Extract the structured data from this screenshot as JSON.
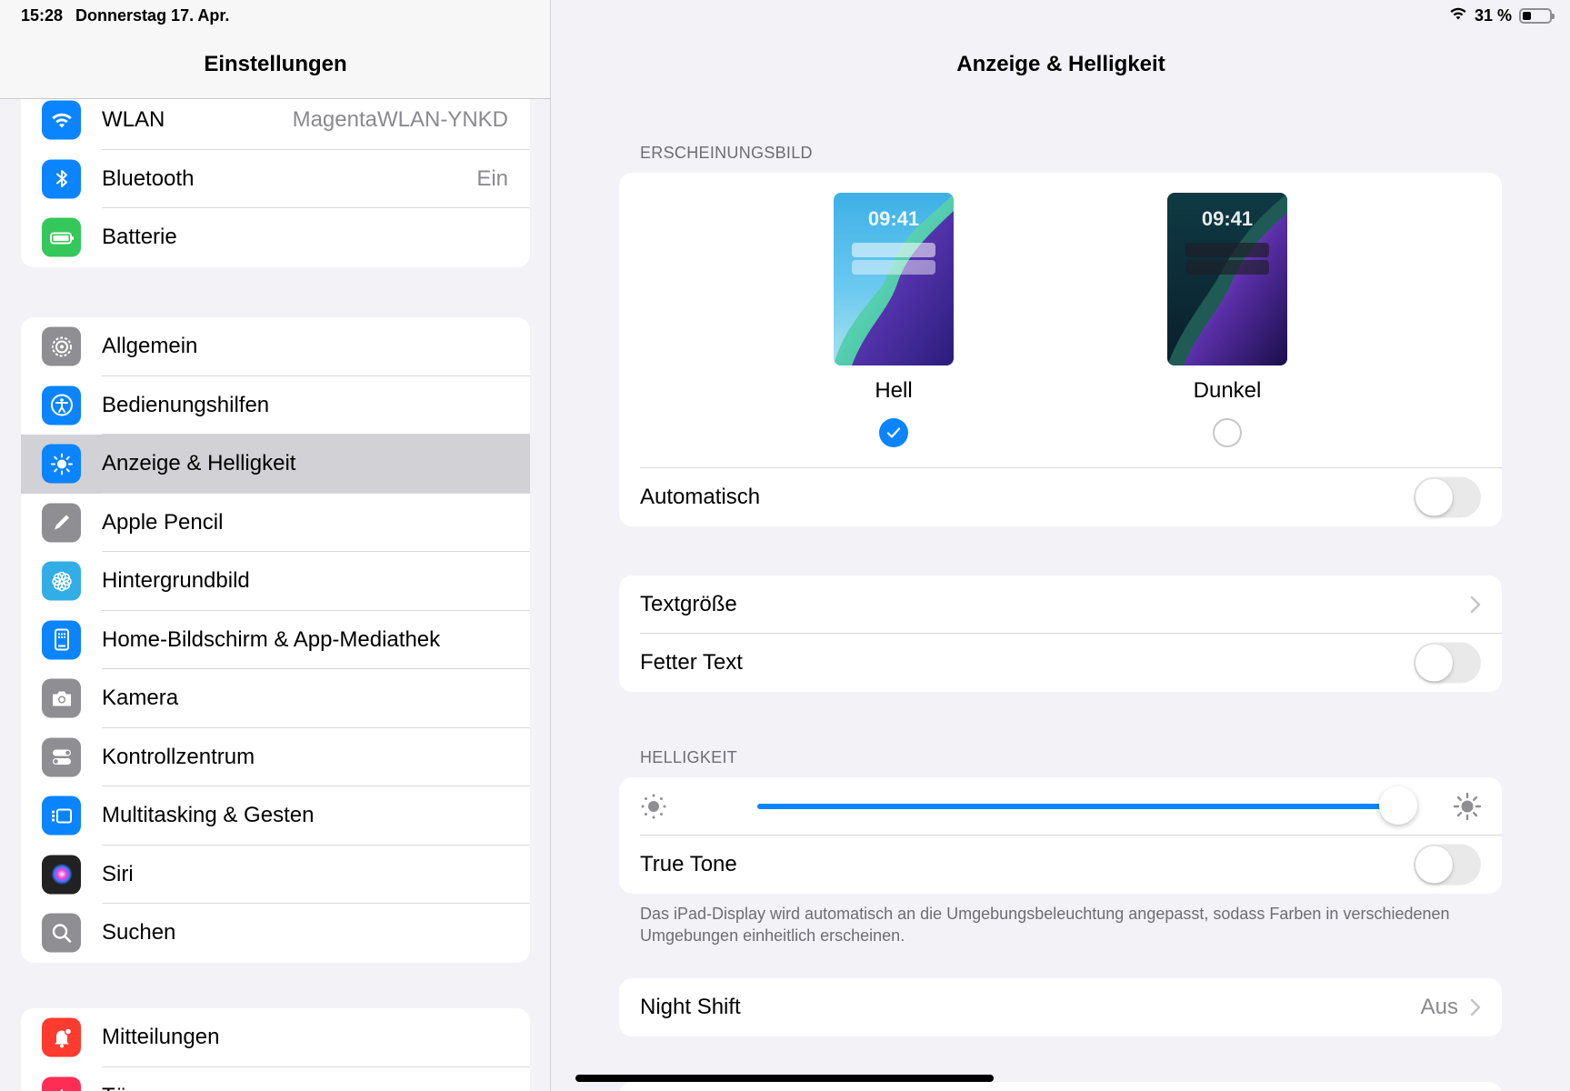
{
  "status": {
    "time": "15:28",
    "date": "Donnerstag 17. Apr.",
    "battery_text": "31 %",
    "battery_level": 0.31
  },
  "sidebar": {
    "title": "Einstellungen",
    "group1": [
      {
        "label": "WLAN",
        "value": "MagentaWLAN-YNKD",
        "icon": "wifi-icon",
        "color": "#0a84ff"
      },
      {
        "label": "Bluetooth",
        "value": "Ein",
        "icon": "bluetooth-icon",
        "color": "#0a84ff"
      },
      {
        "label": "Batterie",
        "value": "",
        "icon": "battery-icon",
        "color": "#34c759"
      }
    ],
    "group2": [
      {
        "label": "Allgemein",
        "icon": "gear-icon",
        "color": "#8e8e93"
      },
      {
        "label": "Bedienungshilfen",
        "icon": "accessibility-icon",
        "color": "#0a84ff"
      },
      {
        "label": "Anzeige & Helligkeit",
        "icon": "sun-icon",
        "color": "#0a84ff",
        "selected": true
      },
      {
        "label": "Apple Pencil",
        "icon": "pencil-icon",
        "color": "#8e8e93"
      },
      {
        "label": "Hintergrundbild",
        "icon": "flower-icon",
        "color": "#32ade6"
      },
      {
        "label": "Home-Bildschirm & App-Mediathek",
        "icon": "home-screen-icon",
        "color": "#0a84ff"
      },
      {
        "label": "Kamera",
        "icon": "camera-icon",
        "color": "#8e8e93"
      },
      {
        "label": "Kontrollzentrum",
        "icon": "switches-icon",
        "color": "#8e8e93"
      },
      {
        "label": "Multitasking & Gesten",
        "icon": "multitasking-icon",
        "color": "#0a84ff"
      },
      {
        "label": "Siri",
        "icon": "siri-icon",
        "color": "#222"
      },
      {
        "label": "Suchen",
        "icon": "magnifier-icon",
        "color": "#8e8e93"
      }
    ],
    "group3": [
      {
        "label": "Mitteilungen",
        "icon": "bell-icon",
        "color": "#ff3b30"
      },
      {
        "label": "Töne",
        "icon": "speaker-icon",
        "color": "#ff2d55"
      }
    ]
  },
  "main": {
    "title": "Anzeige & Helligkeit",
    "appearance_label": "ERSCHEINUNGSBILD",
    "preview_time": "09:41",
    "light_label": "Hell",
    "dark_label": "Dunkel",
    "selected_theme": "light",
    "automatic_label": "Automatisch",
    "automatic_on": false,
    "text_size_label": "Textgröße",
    "bold_text_label": "Fetter Text",
    "bold_text_on": false,
    "brightness_label": "HELLIGKEIT",
    "brightness_value": 0.98,
    "true_tone_label": "True Tone",
    "true_tone_on": false,
    "true_tone_footnote": "Das iPad-Display wird automatisch an die Umgebungsbeleuchtung angepasst, sodass Farben in verschiedenen Umgebungen einheitlich erscheinen.",
    "night_shift_label": "Night Shift",
    "night_shift_value": "Aus"
  },
  "colors": {
    "accent": "#0a84ff",
    "selected_row": "#d1d1d6"
  }
}
